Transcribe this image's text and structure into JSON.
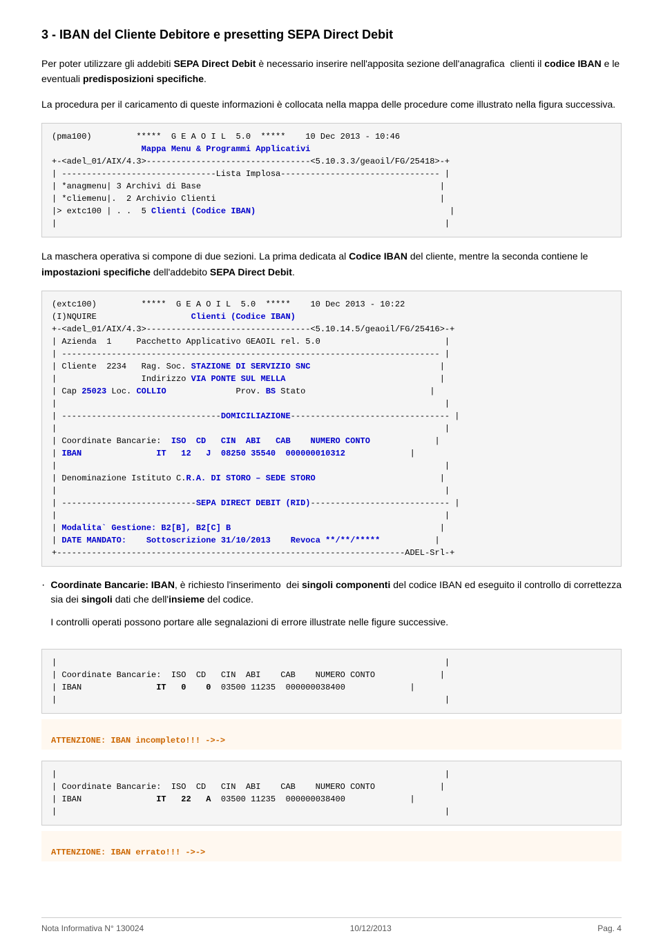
{
  "page": {
    "title": "3 - IBAN del Cliente Debitore e presetting SEPA Direct Debit",
    "intro_p1": "Per poter utilizzare gli addebiti SEPA Direct Debit è necessario inserire nell'apposita sezione dell'anagrafica  clienti il codice IBAN e le eventuali predisposizioni specifiche.",
    "intro_p2": "La procedura per il caricamento di queste informazioni è collocata nella mappa delle procedure come illustrato nella figura successiva.",
    "mid_text1": "La maschera operativa si compone di due sezioni. La prima dedicata al Codice IBAN del cliente, mentre la seconda contiene le impostazioni specifiche dell'addebito SEPA Direct Debit.",
    "bullet_text": "Coordinate Bancarie: IBAN, è richiesto l'inserimento  dei singoli componenti del codice IBAN ed eseguito il controllo di correttezza sia dei singoli dati che dell'insieme del codice.",
    "bullet_text2": "I controlli operati possono portare alle segnalazioni di errore illustrate nelle figure successive."
  },
  "footer": {
    "left": "Nota Informativa  N° 130024",
    "center": "10/12/2013",
    "right": "Pag. 4"
  }
}
